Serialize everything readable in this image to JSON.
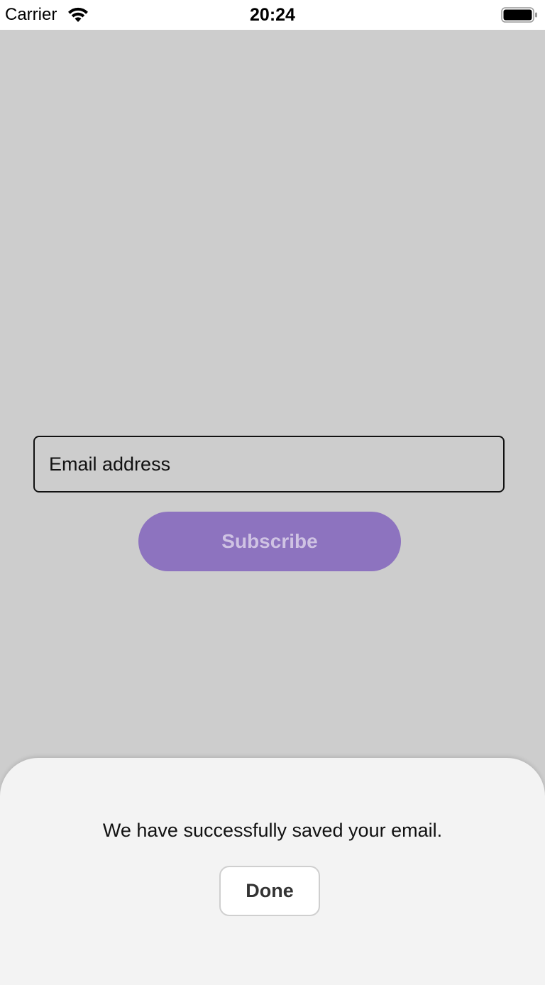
{
  "status_bar": {
    "carrier": "Carrier",
    "time": "20:24",
    "wifi_icon": "wifi-icon",
    "battery_icon": "battery-icon"
  },
  "form": {
    "email_placeholder": "Email address",
    "email_value": "",
    "subscribe_label": "Subscribe"
  },
  "sheet": {
    "message": "We have successfully saved your email.",
    "done_label": "Done"
  },
  "colors": {
    "background": "#cdcdcd",
    "accent": "#8d73bf",
    "sheet": "#f3f3f3"
  }
}
